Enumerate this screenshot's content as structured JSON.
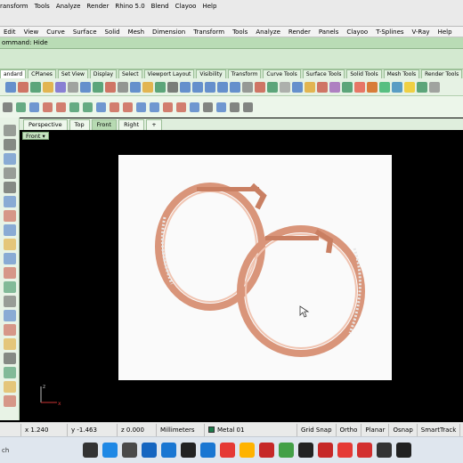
{
  "top_menu": [
    "ransform",
    "Tools",
    "Analyze",
    "Render",
    "Rhino 5.0",
    "Blend",
    "Clayoo",
    "Help"
  ],
  "main_menu": [
    "Edit",
    "View",
    "Curve",
    "Surface",
    "Solid",
    "Mesh",
    "Dimension",
    "Transform",
    "Tools",
    "Analyze",
    "Render",
    "Panels",
    "Clayoo",
    "T-Splines",
    "V-Ray",
    "Help"
  ],
  "command": "ommand: Hide",
  "tool_tabs": [
    "andard",
    "CPlanes",
    "Set View",
    "Display",
    "Select",
    "Viewport Layout",
    "Visibility",
    "Transform",
    "Curve Tools",
    "Surface Tools",
    "Solid Tools",
    "Mesh Tools",
    "Render Tools"
  ],
  "view_tabs": [
    "Perspective",
    "Top",
    "Front",
    "Right"
  ],
  "view_tabs_add": "+",
  "viewport_label": "Front",
  "axis": {
    "z": "z",
    "x": "x"
  },
  "status": {
    "x": "x 1.240",
    "y": "y -1.463",
    "z": "z 0.000",
    "units": "Millimeters",
    "layer": "Metal 01",
    "layer_color": "#1d7a4a",
    "toggles": [
      "Grid Snap",
      "Ortho",
      "Planar",
      "Osnap",
      "SmartTrack"
    ]
  },
  "taskbar": {
    "search": "ch"
  },
  "colors": {
    "rose_gold": "#d9957a",
    "rose_gold_dark": "#b86f55",
    "menu_green": "#b9dcb5"
  }
}
